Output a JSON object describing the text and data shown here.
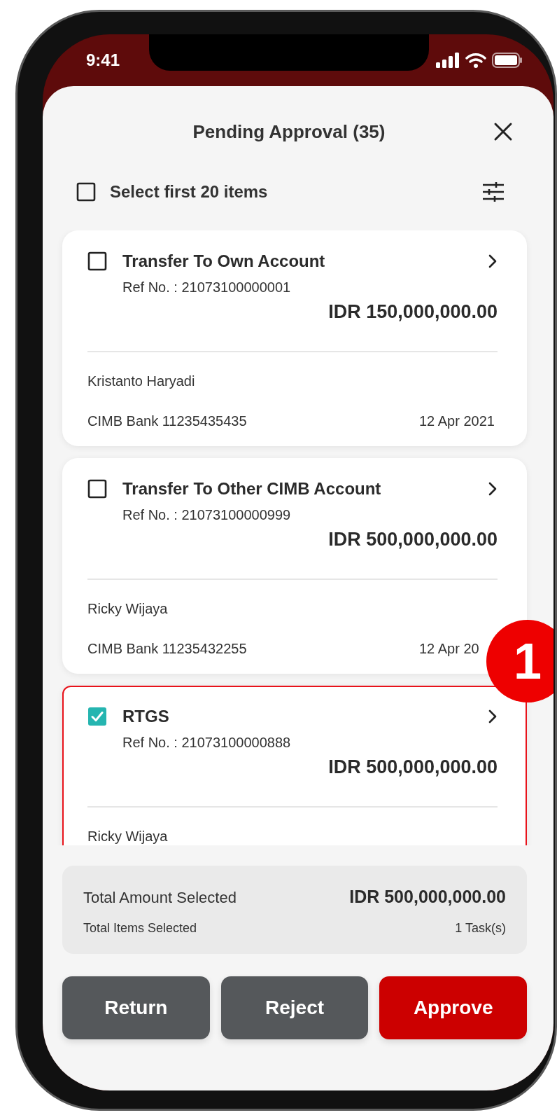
{
  "status_bar": {
    "time": "9:41"
  },
  "header": {
    "title": "Pending Approval (35)"
  },
  "select_all": {
    "label": "Select first 20 items",
    "checked": false
  },
  "items": [
    {
      "title": "Transfer To Own Account",
      "ref": "Ref No. : 21073100000001",
      "amount": "IDR 150,000,000.00",
      "name": "Kristanto Haryadi",
      "account": "CIMB Bank 11235435435",
      "date": "12 Apr 2021",
      "checked": false,
      "highlighted": false
    },
    {
      "title": "Transfer To Other CIMB Account",
      "ref": "Ref No. : 21073100000999",
      "amount": "IDR 500,000,000.00",
      "name": "Ricky Wijaya",
      "account": "CIMB Bank 11235432255",
      "date": "12 Apr 20",
      "checked": false,
      "highlighted": false
    },
    {
      "title": "RTGS",
      "ref": "Ref No. : 21073100000888",
      "amount": "IDR 500,000,000.00",
      "name": "Ricky Wijaya",
      "checked": true,
      "highlighted": true
    }
  ],
  "callout": {
    "label": "1"
  },
  "summary": {
    "amount_label": "Total Amount Selected",
    "amount": "IDR 500,000,000.00",
    "items_label": "Total Items Selected",
    "items": "1 Task(s)"
  },
  "buttons": [
    {
      "label": "Return",
      "kind": "secondary"
    },
    {
      "label": "Reject",
      "kind": "secondary"
    },
    {
      "label": "Approve",
      "kind": "primary"
    }
  ]
}
